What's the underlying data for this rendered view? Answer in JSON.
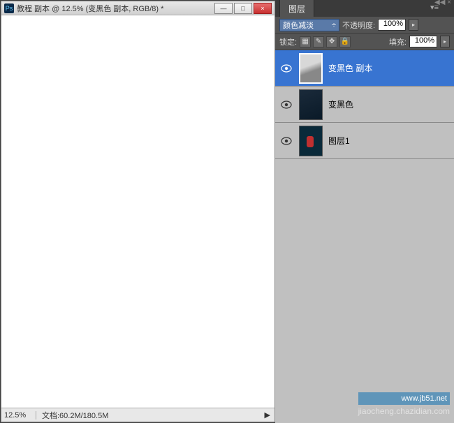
{
  "document": {
    "ps_badge": "Ps",
    "title": "教程 副本 @ 12.5% (变黑色 副本, RGB/8) *",
    "zoom": "12.5%",
    "status": "文档:60.2M/180.5M",
    "win": {
      "min": "—",
      "max": "□",
      "close": "×"
    }
  },
  "panel": {
    "tab": "图层",
    "collapse": "◀◀ ×",
    "menu_icon": "▾≡",
    "blend_mode": "颜色减淡",
    "blend_arrow": "÷",
    "opacity_label": "不透明度:",
    "opacity_value": "100%",
    "lock_label": "锁定:",
    "fill_label": "填充:",
    "fill_value": "100%",
    "step_arrow": "▸"
  },
  "layers": [
    {
      "name": "变黑色 副本",
      "selected": true,
      "thumb": "t1"
    },
    {
      "name": "变黑色",
      "selected": false,
      "thumb": "t2"
    },
    {
      "name": "图层1",
      "selected": false,
      "thumb": "t3"
    }
  ],
  "watermarks": {
    "line1": "www.jb51.net",
    "line2": "jiaocheng.chazidian.com"
  }
}
